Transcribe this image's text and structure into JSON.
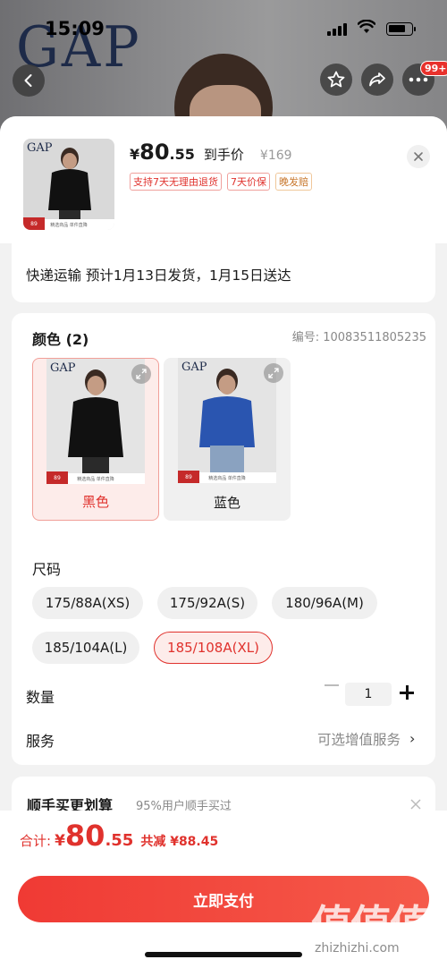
{
  "status_bar": {
    "time": "15:09"
  },
  "background": {
    "brand_logo": "GAP"
  },
  "top_actions": {
    "more_badge": "99+"
  },
  "product": {
    "price_yen": "¥",
    "price_int": "80",
    "price_dec": ".55",
    "price_label": "到手价",
    "original_price": "¥169",
    "tags": [
      "支持7天无理由退货",
      "7天价保",
      "晚发赔"
    ],
    "thumb_strip": "精选商品 单件直降",
    "thumb_tag": "89"
  },
  "shipping": {
    "text": "快递运输 预计1月13日发货，1月15日送达"
  },
  "color_section": {
    "title": "颜色 (2)",
    "sku": "编号: 10083511805235",
    "options": [
      {
        "label": "黑色",
        "selected": true,
        "strip": "精选商品 单件直降",
        "tag": "89"
      },
      {
        "label": "蓝色",
        "selected": false,
        "strip": "精选商品 单件直降",
        "tag": "89"
      }
    ]
  },
  "size_section": {
    "title": "尺码",
    "options": [
      "175/88A(XS)",
      "175/92A(S)",
      "180/96A(M)",
      "185/104A(L)",
      "185/108A(XL)"
    ],
    "selected": "185/108A(XL)"
  },
  "quantity": {
    "label": "数量",
    "value": "1"
  },
  "service": {
    "label": "服务",
    "value": "可选增值服务"
  },
  "bundle": {
    "title": "顺手买更划算",
    "subtitle": "95%用户顺手买过"
  },
  "footer": {
    "total_label": "合计:",
    "total_yen": "¥",
    "total_int": "80",
    "total_dec": ".55",
    "saved": "共减 ¥88.45",
    "pay_button": "立即支付"
  },
  "watermark": {
    "text": "值值值",
    "url": "zhizhizhi.com"
  },
  "colors": {
    "accent": "#e0322d",
    "pay_gradient_start": "#f03a34",
    "pay_gradient_end": "#f55a4a"
  }
}
